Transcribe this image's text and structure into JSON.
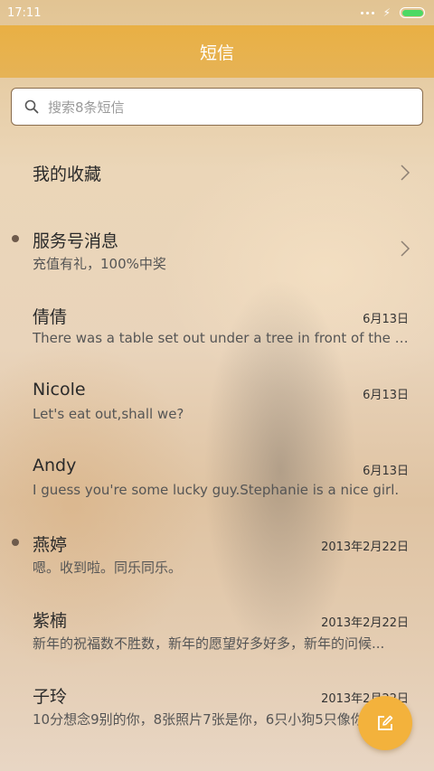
{
  "status_bar": {
    "time": "17:11",
    "battery_level": 1.0
  },
  "header": {
    "title": "短信"
  },
  "search": {
    "placeholder": "搜索8条短信"
  },
  "conversations": [
    {
      "title": "我的收藏",
      "subtitle": "",
      "date": "",
      "unread": false,
      "chevron": true
    },
    {
      "title": "服务号消息",
      "subtitle": "充值有礼，100%中奖",
      "date": "",
      "unread": true,
      "chevron": true
    },
    {
      "title": "倩倩",
      "subtitle": "There was a table set out under a tree in front of the ho...",
      "date": "6月13日",
      "unread": false,
      "chevron": false
    },
    {
      "title": "Nicole",
      "subtitle": "Let's eat out,shall we?",
      "date": "6月13日",
      "unread": false,
      "chevron": false
    },
    {
      "title": "Andy",
      "subtitle": "I guess you're some lucky guy.Stephanie is a nice girl.",
      "date": "6月13日",
      "unread": false,
      "chevron": false
    },
    {
      "title": "燕婷",
      "subtitle": "嗯。收到啦。同乐同乐。",
      "date": "2013年2月22日",
      "unread": true,
      "chevron": false
    },
    {
      "title": "紫楠",
      "subtitle": "新年的祝福数不胜数，新年的愿望好多好多，新年的问候...",
      "date": "2013年2月22日",
      "unread": false,
      "chevron": false
    },
    {
      "title": "子玲",
      "subtitle": "10分想念9别的你，8张照片7张是你，6只小狗5只像你",
      "date": "2013年2月22日",
      "unread": false,
      "chevron": false
    }
  ],
  "icons": {
    "search": "search-icon",
    "chevron": "chevron-right-icon",
    "compose": "compose-icon",
    "unread": "unread-dot"
  },
  "colors": {
    "header": "#e9b044",
    "fab": "#f3b23c",
    "unread_dot": "#6e5b4c"
  }
}
